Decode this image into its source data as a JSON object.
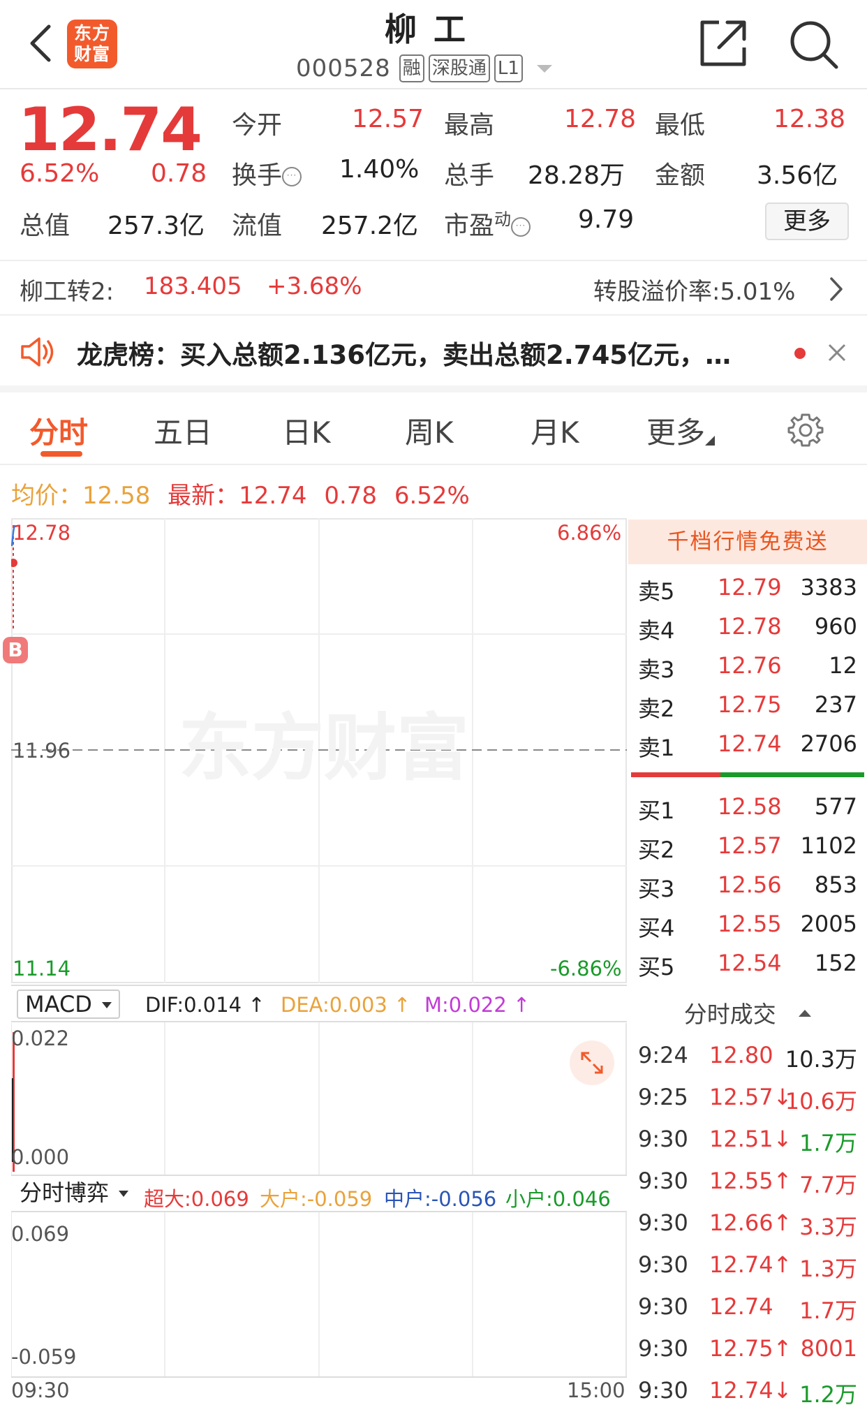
{
  "header": {
    "logo_line1": "东方",
    "logo_line2": "财富",
    "title": "柳工",
    "code": "000528",
    "tags": [
      "融",
      "深股通",
      "L1"
    ]
  },
  "quote": {
    "price": "12.74",
    "change_pct": "6.52%",
    "change": "0.78",
    "open_label": "今开",
    "open": "12.57",
    "high_label": "最高",
    "high": "12.78",
    "low_label": "最低",
    "low": "12.38",
    "turnover_label": "换手",
    "turnover": "1.40%",
    "volume_label": "总手",
    "volume": "28.28万",
    "amount_label": "金额",
    "amount": "3.56亿",
    "mktcap_label": "总值",
    "mktcap": "257.3亿",
    "float_label": "流值",
    "float": "257.2亿",
    "pe_label": "市盈",
    "pe_sup": "动",
    "pe": "9.79",
    "more_button": "更多"
  },
  "bond": {
    "name": "柳工转2:",
    "price": "183.405",
    "pct": "+3.68%",
    "premium": "转股溢价率:5.01%"
  },
  "notice": {
    "text": "龙虎榜：买入总额2.136亿元，卖出总额2.745亿元，…"
  },
  "tabs": [
    {
      "label": "分时"
    },
    {
      "label": "五日"
    },
    {
      "label": "日K"
    },
    {
      "label": "周K"
    },
    {
      "label": "月K"
    },
    {
      "label": "更多"
    }
  ],
  "infoline": {
    "avg_label": "均价：",
    "avg": "12.58",
    "latest_label": "最新：",
    "latest": "12.74",
    "change": "0.78",
    "pct": "6.52%"
  },
  "chart": {
    "y_top": "12.78",
    "y_mid": "11.96",
    "y_bottom": "11.14",
    "pct_top": "6.86%",
    "pct_bottom": "-6.86%",
    "marker": "B",
    "watermark": "东方财富",
    "time_start": "09:30",
    "time_end": "15:00"
  },
  "macd": {
    "selector": "MACD",
    "dif": "DIF:0.014 ↑",
    "dea": "DEA:0.003 ↑",
    "m": "M:0.022 ↑",
    "y_top": "0.022",
    "y_bottom": "0.000"
  },
  "bobo": {
    "selector": "分时博弈",
    "super": "超大:0.069",
    "large": "大户:-0.059",
    "mid": "中户:-0.056",
    "small": "小户:0.046",
    "y_top": "0.069",
    "y_bottom": "-0.059"
  },
  "book": {
    "banner": "千档行情免费送",
    "sells": [
      {
        "label": "卖5",
        "price": "12.79",
        "vol": "3383"
      },
      {
        "label": "卖4",
        "price": "12.78",
        "vol": "960"
      },
      {
        "label": "卖3",
        "price": "12.76",
        "vol": "12"
      },
      {
        "label": "卖2",
        "price": "12.75",
        "vol": "237"
      },
      {
        "label": "卖1",
        "price": "12.74",
        "vol": "2706"
      }
    ],
    "buys": [
      {
        "label": "买1",
        "price": "12.58",
        "vol": "577"
      },
      {
        "label": "买2",
        "price": "12.57",
        "vol": "1102"
      },
      {
        "label": "买3",
        "price": "12.56",
        "vol": "853"
      },
      {
        "label": "买4",
        "price": "12.55",
        "vol": "2005"
      },
      {
        "label": "买5",
        "price": "12.54",
        "vol": "152"
      }
    ],
    "trades_title": "分时成交",
    "trades": [
      {
        "time": "9:24",
        "price": "12.80",
        "vol": "10.3万",
        "vol_color": "#222"
      },
      {
        "time": "9:25",
        "price": "12.57↓",
        "vol": "10.6万",
        "vol_color": "#e53a3a"
      },
      {
        "time": "9:30",
        "price": "12.51↓",
        "vol": "1.7万",
        "vol_color": "#1a9a2a"
      },
      {
        "time": "9:30",
        "price": "12.55↑",
        "vol": "7.7万",
        "vol_color": "#e53a3a"
      },
      {
        "time": "9:30",
        "price": "12.66↑",
        "vol": "3.3万",
        "vol_color": "#e53a3a"
      },
      {
        "time": "9:30",
        "price": "12.74↑",
        "vol": "1.3万",
        "vol_color": "#e53a3a"
      },
      {
        "time": "9:30",
        "price": "12.74",
        "vol": "1.7万",
        "vol_color": "#e53a3a"
      },
      {
        "time": "9:30",
        "price": "12.75↑",
        "vol": "8001",
        "vol_color": "#e53a3a"
      },
      {
        "time": "9:30",
        "price": "12.74↓",
        "vol": "1.2万",
        "vol_color": "#1a9a2a"
      }
    ]
  }
}
